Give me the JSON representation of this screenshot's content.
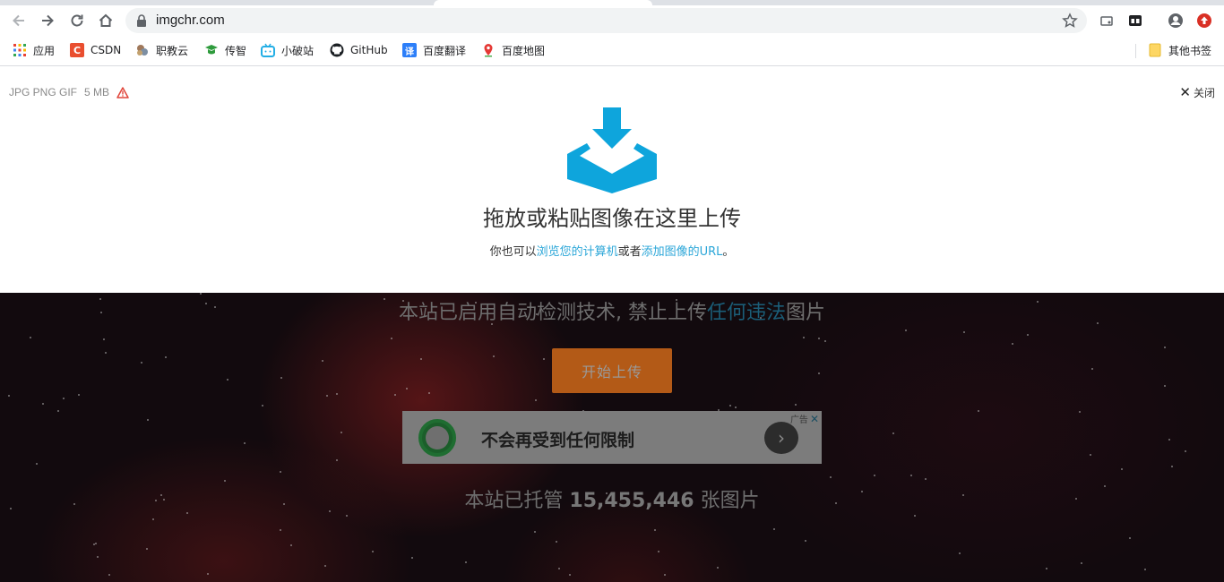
{
  "browser": {
    "url": "imgchr.com",
    "bookmarks": [
      {
        "label": "应用",
        "icon": "apps-grid-icon"
      },
      {
        "label": "CSDN",
        "icon": "csdn-icon",
        "color": "#e94e2f"
      },
      {
        "label": "职教云",
        "icon": "zhijiaoyun-icon"
      },
      {
        "label": "传智",
        "icon": "chuanzhi-icon",
        "color": "#2e9b3c"
      },
      {
        "label": "小破站",
        "icon": "bilibili-icon",
        "color": "#23aee5"
      },
      {
        "label": "GitHub",
        "icon": "github-icon"
      },
      {
        "label": "百度翻译",
        "icon": "baidu-translate-icon",
        "color": "#2d7ff9"
      },
      {
        "label": "百度地图",
        "icon": "baidu-map-icon",
        "color": "#e53935"
      }
    ],
    "other_bookmarks": "其他书签"
  },
  "upload": {
    "formats": "JPG PNG GIF",
    "max_size": "5 MB",
    "close_label": "关闭",
    "title": "拖放或粘贴图像在这里上传",
    "sub_prefix": "你也可以",
    "browse_link": "浏览您的计算机",
    "sub_or": "或者",
    "url_link": "添加图像的URL",
    "sub_suffix": "。",
    "accent_color": "#0ea5dc"
  },
  "page": {
    "notice_prefix": "本站已启用自动检测技术, 禁止上传",
    "notice_link": "任何违法",
    "notice_suffix": "图片",
    "start_button": "开始上传",
    "ad_text": "不会再受到任何限制",
    "ad_tag": "广告",
    "ad_close": "✕",
    "stats_prefix": "本站已托管",
    "stats_count": "15,455,446",
    "stats_suffix": "张图片"
  }
}
